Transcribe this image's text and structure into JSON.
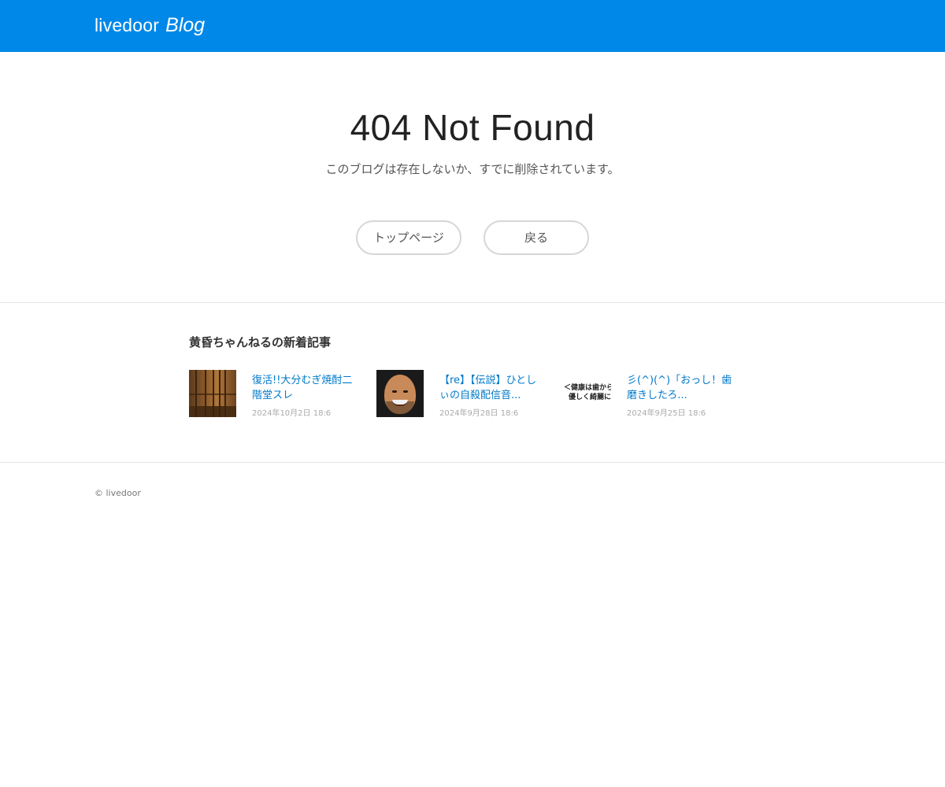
{
  "header": {
    "logo_main": "livedoor",
    "logo_blog": "Blog",
    "background_color": "#0088e8"
  },
  "error": {
    "title": "404 Not Found",
    "message": "このブログは存在しないか、すでに削除されています。"
  },
  "buttons": {
    "top_page": "トップページ",
    "back": "戻る"
  },
  "recent": {
    "heading": "黄昏ちゃんねるの新着記事",
    "articles": [
      {
        "title": "復活!!大分むぎ焼酎二階堂スレ",
        "date": "2024年10月2日 18:6",
        "thumb": "fence-photo"
      },
      {
        "title": "【re】【伝説】ひとしぃの自殺配信音...",
        "date": "2024年9月28日 18:6",
        "thumb": "face-photo"
      },
      {
        "title": "彡(^)(^)「おっし！歯磨きしたろ...",
        "date": "2024年9月25日 18:6",
        "thumb": "text-image",
        "thumb_lines": [
          "＜健康は歯から",
          "優しく綺麗に"
        ]
      }
    ]
  },
  "footer": {
    "copyright": "© livedoor"
  },
  "colors": {
    "link": "#0079c9",
    "date": "#aaaaaa",
    "divider": "#e5e5e5"
  }
}
